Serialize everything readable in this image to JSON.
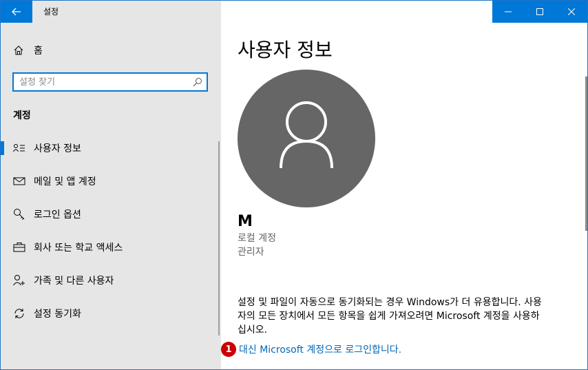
{
  "window": {
    "title": "설정"
  },
  "sidebar": {
    "home_label": "홈",
    "search": {
      "placeholder": "설정 찾기",
      "value": ""
    },
    "section_title": "계정",
    "items": [
      {
        "label": "사용자 정보",
        "icon": "user-info-icon",
        "selected": true
      },
      {
        "label": "메일 및 앱 계정",
        "icon": "mail-icon",
        "selected": false
      },
      {
        "label": "로그인 옵션",
        "icon": "key-icon",
        "selected": false
      },
      {
        "label": "회사 또는 학교 액세스",
        "icon": "briefcase-icon",
        "selected": false
      },
      {
        "label": "가족 및 다른 사용자",
        "icon": "person-add-icon",
        "selected": false
      },
      {
        "label": "설정 동기화",
        "icon": "sync-icon",
        "selected": false
      }
    ]
  },
  "main": {
    "title": "사용자 정보",
    "user": {
      "name": "M",
      "account_type": "로컬 계정",
      "role": "관리자"
    },
    "description": "설정 및 파일이 자동으로 동기화되는 경우 Windows가 더 유용합니다. 사용자의 모든 장치에서 모든 항목을 쉽게 가져오려면 Microsoft 계정을 사용하십시오.",
    "signin_link": "대신 Microsoft 계정으로 로그인합니다.",
    "badge": "1"
  },
  "colors": {
    "accent": "#0078d7",
    "link": "#0067b8",
    "sidebar_bg": "#e6e6e6",
    "avatar_bg": "#666666",
    "badge": "#cc0000"
  }
}
